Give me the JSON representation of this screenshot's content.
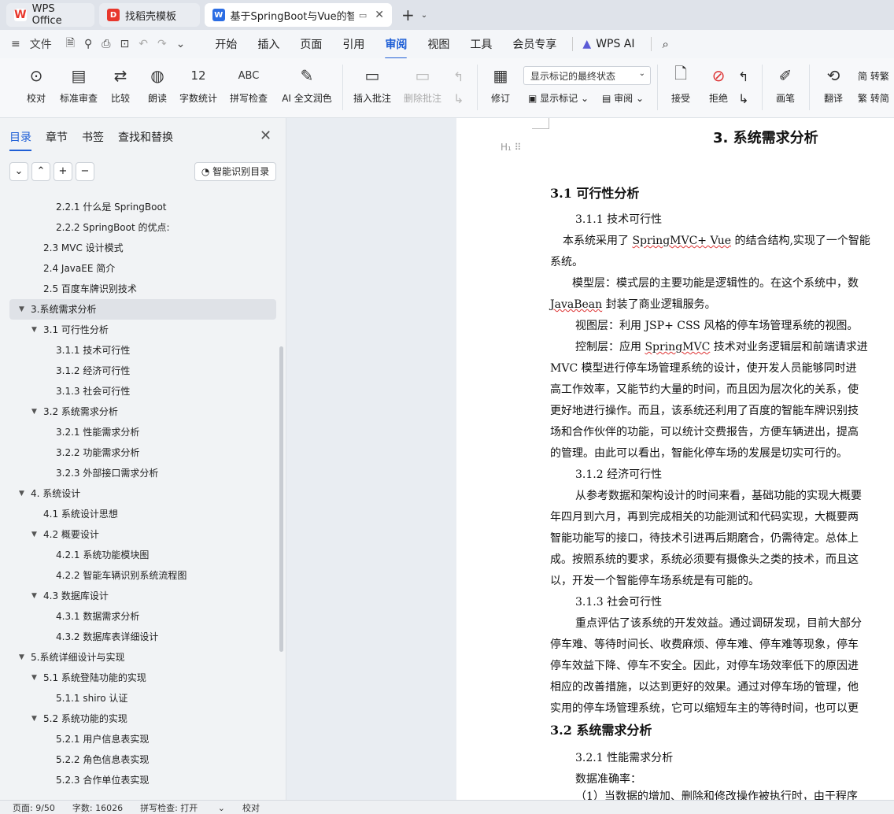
{
  "tabs": [
    {
      "label": "WPS Office",
      "icon": "wps-logo-icon"
    },
    {
      "label": "找稻壳模板",
      "icon": "docer-icon"
    },
    {
      "label": "基于SpringBoot与Vue的智能",
      "icon": "word-doc-icon"
    }
  ],
  "menu": {
    "file": "文件",
    "items": [
      "开始",
      "插入",
      "页面",
      "引用",
      "审阅",
      "视图",
      "工具",
      "会员专享",
      "WPS AI"
    ],
    "active": "审阅"
  },
  "ribbon": {
    "proofread": "校对",
    "standard_review": "标准审查",
    "compare": "比较",
    "read_aloud": "朗读",
    "word_count": "字数统计",
    "spell_check": "拼写检查",
    "ai_polish": "AI 全文润色",
    "insert_comment": "插入批注",
    "delete_comment": "删除批注",
    "revise": "修订",
    "show_markup_dropdown": "显示标记的最终状态",
    "show_markup": "显示标记",
    "review": "审阅",
    "accept": "接受",
    "reject": "拒绝",
    "pen": "画笔",
    "translate": "翻译",
    "simp_to_trad": "简 转繁",
    "trad_to_simp": "繁 转简"
  },
  "nav": {
    "tabs": [
      "目录",
      "章节",
      "书签",
      "查找和替换"
    ],
    "smart_toc": "智能识别目录",
    "toc": [
      {
        "text": "2.2.1  什么是 SpringBoot",
        "level": 3
      },
      {
        "text": "2.2.2 SpringBoot 的优点:",
        "level": 3
      },
      {
        "text": "2.3 MVC 设计模式",
        "level": 2
      },
      {
        "text": "2.4 JavaEE 简介",
        "level": 2
      },
      {
        "text": "2.5  百度车牌识别技术",
        "level": 2
      },
      {
        "text": "3.系统需求分析",
        "level": 1,
        "expand": true,
        "selected": true
      },
      {
        "text": "3.1  可行性分析",
        "level": 2,
        "expand": true
      },
      {
        "text": "3.1.1  技术可行性",
        "level": 3
      },
      {
        "text": "3.1.2  经济可行性",
        "level": 3
      },
      {
        "text": "3.1.3  社会可行性",
        "level": 3
      },
      {
        "text": "3.2  系统需求分析",
        "level": 2,
        "expand": true
      },
      {
        "text": "3.2.1  性能需求分析",
        "level": 3
      },
      {
        "text": "3.2.2  功能需求分析",
        "level": 3
      },
      {
        "text": "3.2.3  外部接口需求分析",
        "level": 3
      },
      {
        "text": "4.  系统设计",
        "level": 1,
        "expand": true
      },
      {
        "text": "4.1  系统设计思想",
        "level": 2
      },
      {
        "text": "4.2  概要设计",
        "level": 2,
        "expand": true
      },
      {
        "text": "4.2.1  系统功能模块图",
        "level": 3
      },
      {
        "text": "4.2.2  智能车辆识别系统流程图",
        "level": 3
      },
      {
        "text": "4.3  数据库设计",
        "level": 2,
        "expand": true
      },
      {
        "text": "4.3.1  数据需求分析",
        "level": 3
      },
      {
        "text": "4.3.2  数据库表详细设计",
        "level": 3
      },
      {
        "text": "5.系统详细设计与实现",
        "level": 1,
        "expand": true
      },
      {
        "text": "5.1  系统登陆功能的实现",
        "level": 2,
        "expand": true
      },
      {
        "text": "5.1.1 shiro 认证",
        "level": 3
      },
      {
        "text": "5.2  系统功能的实现",
        "level": 2,
        "expand": true
      },
      {
        "text": "5.2.1  用户信息表实现",
        "level": 3
      },
      {
        "text": "5.2.2  角色信息表实现",
        "level": 3
      },
      {
        "text": "5.2.3  合作单位表实现",
        "level": 3
      }
    ]
  },
  "doc": {
    "chapter": "3. 系统需求分析",
    "s31": "3.1  可行性分析",
    "s311": "3.1.1  技术可行性",
    "p1a_pre": "本系统采用了  ",
    "p1a_w": "SpringMVC+ Vue",
    "p1a_post": " 的结合结构,实现了一个智能",
    "p1b": "系统。",
    "p2a": "模型层：模式层的主要功能是逻辑性的。在这个系统中，数",
    "p2b_w": "JavaBean",
    "p2b_post": " 封装了商业逻辑服务。",
    "p3": "视图层：利用  JSP+ CSS 风格的停车场管理系统的视图。",
    "p4a_pre": "控制层：应用  ",
    "p4a_w": "SpringMVC",
    "p4a_post": " 技术对业务逻辑层和前端请求进",
    "p4b": "MVC 模型进行停车场管理系统的设计，使开发人员能够同时进",
    "p4c": "高工作效率，又能节约大量的时间，而且因为层次化的关系，使",
    "p4d": "更好地进行操作。而且，该系统还利用了百度的智能车牌识别技",
    "p4e": "场和合作伙伴的功能，可以统计交费报告，方便车辆进出，提高",
    "p4f": "的管理。由此可以看出，智能化停车场的发展是切实可行的。",
    "s312": "3.1.2  经济可行性",
    "p5a": "从参考数据和架构设计的时间来看，基础功能的实现大概要",
    "p5b": "年四月到六月，再到完成相关的功能测试和代码实现，大概要两",
    "p5c": "智能功能写的接口，待技术引进再后期磨合，仍需待定。总体上",
    "p5d": "成。按照系统的要求，系统必须要有摄像头之类的技术，而且这",
    "p5e": "以，开发一个智能停车场系统是有可能的。",
    "s313": "3.1.3  社会可行性",
    "p6a": "重点评估了该系统的开发效益。通过调研发现，目前大部分",
    "p6b": "停车难、等待时间长、收费麻烦、停车难、停车难等现象，停车",
    "p6c": "停车效益下降、停车不安全。因此，对停车场效率低下的原因进",
    "p6d": "相应的改善措施，以达到更好的效果。通过对停车场的管理，他",
    "p6e": "实用的停车场管理系统，它可以缩短车主的等待时间，也可以更",
    "s32": "3.2  系统需求分析",
    "s321": "3.2.1  性能需求分析",
    "p7": "数据准确率：",
    "p8": "（1）当数据的增加、删除和修改操作被执行时，由于程序"
  },
  "status": {
    "page": "页面: 9/50",
    "words": "字数: 16026",
    "spell": "拼写检查: 打开",
    "proof": "校对"
  },
  "colors": {
    "accent": "#1f5fd6",
    "wps_red": "#e8372c"
  }
}
